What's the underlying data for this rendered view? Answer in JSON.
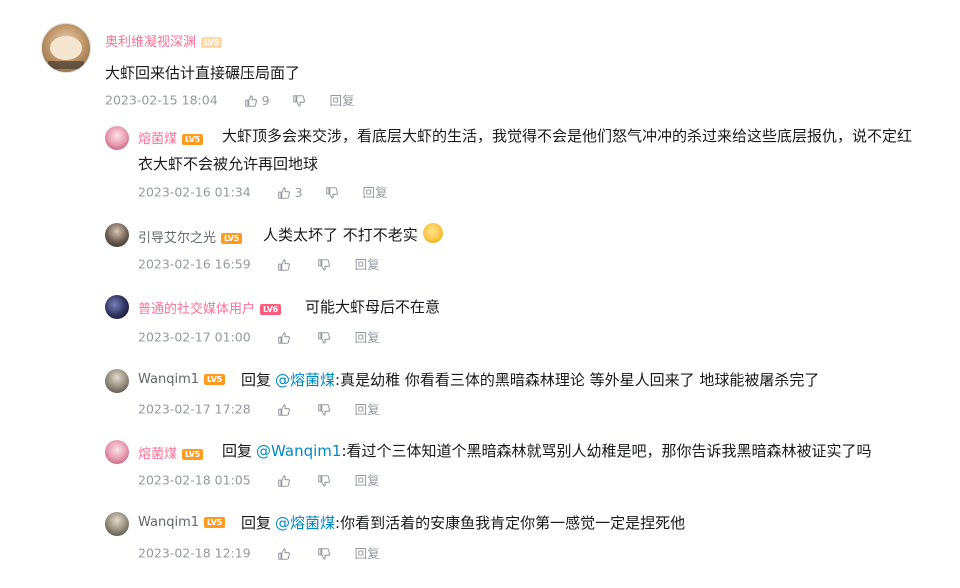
{
  "comments": [
    {
      "username": "奥利维凝视深渊",
      "level": "LV5",
      "text": "大虾回来估计直接碾压局面了",
      "date": "2023-02-15 18:04",
      "likes": "9",
      "reply_label": "回复"
    }
  ],
  "replies": [
    {
      "username": "熔菌煤",
      "level": "LV5",
      "text_line1": "大虾顶多会来交涉，看底层大虾的生活，我觉得不会是他们怒气冲冲的杀过来给这些底层报仇，说不定红",
      "text_line2": "衣大虾不会被允许再回地球",
      "date": "2023-02-16 01:34",
      "likes": "3",
      "reply_label": "回复"
    },
    {
      "username": "引导艾尔之光",
      "level": "LV5",
      "text": "人类太坏了   不打不老实",
      "emoji": "doge-emoji",
      "date": "2023-02-16 16:59",
      "reply_label": "回复"
    },
    {
      "username": "普通的社交媒体用户",
      "level": "LV6",
      "text": "可能大虾母后不在意",
      "date": "2023-02-17 01:00",
      "reply_label": "回复"
    },
    {
      "username": "Wanqim1",
      "level": "LV5",
      "reply_word": "回复",
      "at": "@熔菌煤",
      "text": ":真是幼稚  你看看三体的黑暗森林理论   等外星人回来了  地球能被屠杀完了",
      "date": "2023-02-17 17:28",
      "reply_label": "回复"
    },
    {
      "username": "熔菌煤",
      "level": "LV5",
      "reply_word": "回复",
      "at": "@Wanqim1",
      "text": ":看过个三体知道个黑暗森林就骂别人幼稚是吧，那你告诉我黑暗森林被证实了吗",
      "date": "2023-02-18 01:05",
      "reply_label": "回复"
    },
    {
      "username": "Wanqim1",
      "level": "LV5",
      "reply_word": "回复",
      "at": "@熔菌煤",
      "text": ":你看到活着的安康鱼我肯定你第一感觉一定是捏死他",
      "date": "2023-02-18 12:19",
      "reply_label": "回复"
    }
  ],
  "colors": {
    "vip_name": "#fb7299",
    "normal_name": "#61666d",
    "mention": "#008ac5",
    "meta": "#9499a0"
  }
}
